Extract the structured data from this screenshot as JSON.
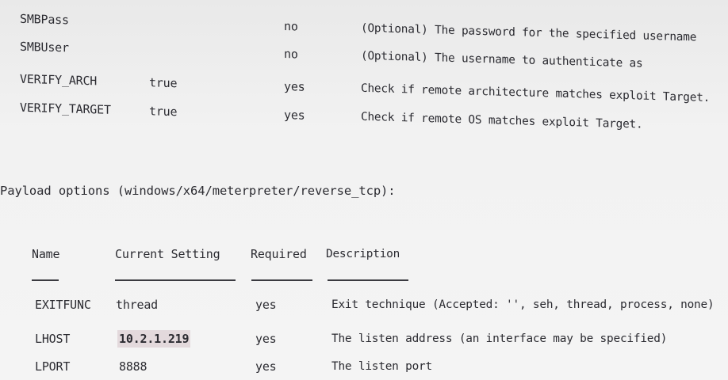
{
  "module_options": [
    {
      "name": "SMBPass",
      "setting": "",
      "required": "no",
      "description": "(Optional) The password for the specified username"
    },
    {
      "name": "SMBUser",
      "setting": "",
      "required": "no",
      "description": "(Optional) The username to authenticate as"
    },
    {
      "name": "VERIFY_ARCH",
      "setting": "true",
      "required": "yes",
      "description": "Check if remote architecture matches exploit Target."
    },
    {
      "name": "VERIFY_TARGET",
      "setting": "true",
      "required": "yes",
      "description": "Check if remote OS matches exploit Target."
    }
  ],
  "payload": {
    "heading": "Payload options (windows/x64/meterpreter/reverse_tcp):",
    "headers": {
      "name": "Name",
      "setting": "Current Setting",
      "required": "Required",
      "description": "Description"
    },
    "rows": [
      {
        "name": "EXITFUNC",
        "setting": "thread",
        "required": "yes",
        "description": "Exit technique (Accepted: '', seh, thread, process, none)"
      },
      {
        "name": "LHOST",
        "setting": "10.2.1.219",
        "required": "yes",
        "description": "The listen address (an interface may be specified)"
      },
      {
        "name": "LPORT",
        "setting": "8888",
        "required": "yes",
        "description": "The listen port"
      }
    ]
  }
}
